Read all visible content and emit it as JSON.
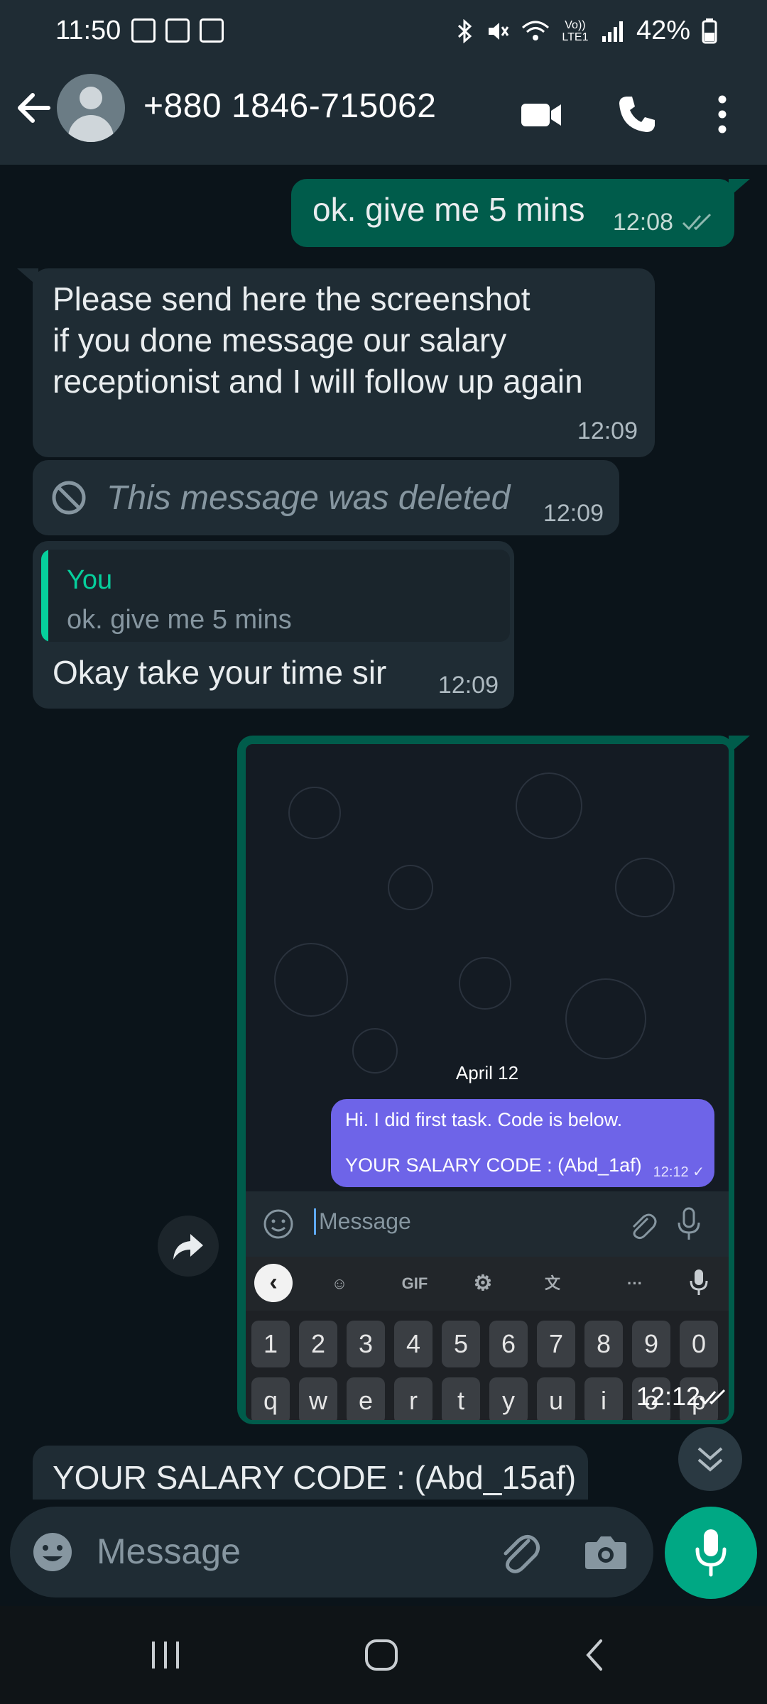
{
  "status_bar": {
    "time": "11:50",
    "volte_label": "Vo)) LTE1",
    "battery": "42%"
  },
  "header": {
    "title": "+880 1846-715062"
  },
  "messages": [
    {
      "id": "m1",
      "text": "ok. give me 5 mins",
      "time": "12:08",
      "ticks": "read"
    },
    {
      "id": "m2",
      "lines": [
        "Please send here the screenshot",
        "if you done message our salary",
        "receptionist and I will follow up again"
      ],
      "time": "12:09"
    },
    {
      "id": "m3",
      "text": "This message was deleted",
      "time": "12:09"
    },
    {
      "id": "m4",
      "quote_name": "You",
      "quote_text": "ok. give me 5 mins",
      "text": "Okay take your time sir",
      "time": "12:09"
    },
    {
      "id": "m5",
      "time": "12:12",
      "ticks": "read",
      "screenshot": {
        "date_chip": "April 12",
        "msg_line1": "Hi. I did first task. Code is below.",
        "msg_line2": "YOUR SALARY CODE : (Abd_1af)",
        "msg_time": "12:12",
        "input_placeholder": "Message",
        "keyboard_gif": "GIF",
        "keyboard_more": "···",
        "number_row": [
          "1",
          "2",
          "3",
          "4",
          "5",
          "6",
          "7",
          "8",
          "9",
          "0"
        ],
        "letter_row": [
          "q",
          "w",
          "e",
          "r",
          "t",
          "y",
          "u",
          "i",
          "o",
          "p"
        ]
      }
    },
    {
      "id": "m6",
      "text": "YOUR SALARY CODE : (Abd_15af)"
    }
  ],
  "composer": {
    "placeholder": "Message"
  },
  "colors": {
    "outgoing": "#005c4b",
    "incoming": "#1f2c34",
    "accent": "#00a884",
    "purple_bubble": "#6e64e8"
  }
}
